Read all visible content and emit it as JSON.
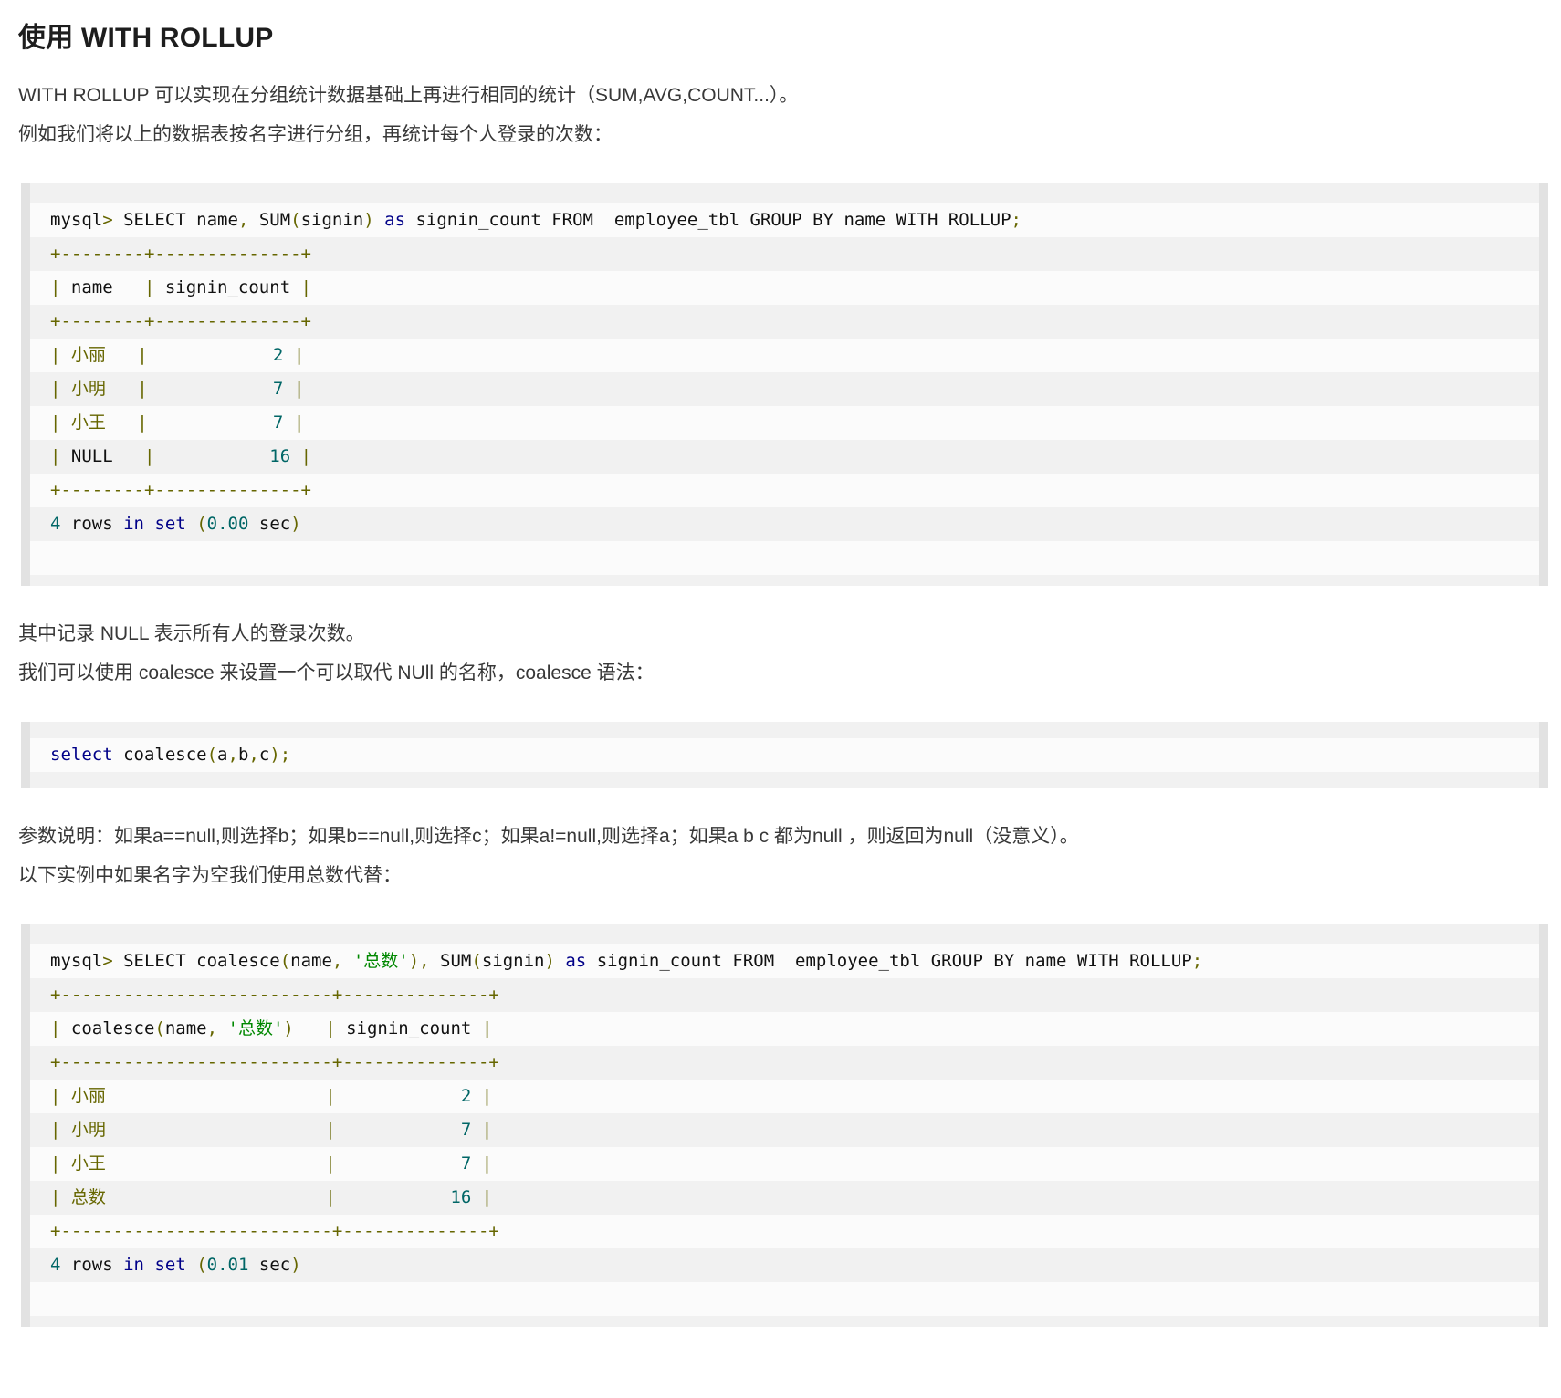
{
  "page_title": "使用 WITH ROLLUP",
  "paragraphs": {
    "intro1": "WITH ROLLUP 可以实现在分组统计数据基础上再进行相同的统计（SUM,AVG,COUNT...）。",
    "intro2": "例如我们将以上的数据表按名字进行分组，再统计每个人登录的次数：",
    "null_note": "其中记录 NULL 表示所有人的登录次数。",
    "coalesce_intro": "我们可以使用 coalesce 来设置一个可以取代 NUll 的名称，coalesce 语法：",
    "param_note": "参数说明：如果a==null,则选择b；如果b==null,则选择c；如果a!=null,则选择a；如果a b c 都为null ，则返回为null（没意义）。",
    "example_intro": "以下实例中如果名字为空我们使用总数代替："
  },
  "colors": {
    "code_plain": "#111111",
    "code_keyword": "#000088",
    "code_punctuation": "#666600",
    "code_literal": "#006666",
    "code_string": "#008800",
    "stripe_light": "#fbfbfb",
    "stripe_dark": "#f1f1f1",
    "block_side_border": "#e2e2e2"
  },
  "result_tables": [
    {
      "columns": [
        "name",
        "signin_count"
      ],
      "rows": [
        [
          "小丽",
          2
        ],
        [
          "小明",
          7
        ],
        [
          "小王",
          7
        ],
        [
          "NULL",
          16
        ]
      ],
      "status": "4 rows in set (0.00 sec)"
    },
    {
      "columns": [
        "coalesce(name, '总数')",
        "signin_count"
      ],
      "rows": [
        [
          "小丽",
          2
        ],
        [
          "小明",
          7
        ],
        [
          "小王",
          7
        ],
        [
          "总数",
          16
        ]
      ],
      "status": "4 rows in set (0.01 sec)"
    }
  ],
  "code_blocks": [
    {
      "name": "rollup-query",
      "lines": [
        [
          [
            "pln",
            "mysql"
          ],
          [
            "pun",
            ">"
          ],
          [
            "pln",
            " SELECT name"
          ],
          [
            "pun",
            ","
          ],
          [
            "pln",
            " SUM"
          ],
          [
            "pun",
            "("
          ],
          [
            "pln",
            "signin"
          ],
          [
            "pun",
            ")"
          ],
          [
            "pln",
            " "
          ],
          [
            "kwd",
            "as"
          ],
          [
            "pln",
            " signin_count FROM  employee_tbl GROUP BY name WITH ROLLUP"
          ],
          [
            "pun",
            ";"
          ]
        ],
        [
          [
            "pun",
            "+--------+--------------+"
          ]
        ],
        [
          [
            "pun",
            "|"
          ],
          [
            "pln",
            " name   "
          ],
          [
            "pun",
            "|"
          ],
          [
            "pln",
            " signin_count "
          ],
          [
            "pun",
            "|"
          ]
        ],
        [
          [
            "pun",
            "+--------+--------------+"
          ]
        ],
        [
          [
            "pun",
            "| 小丽   |"
          ],
          [
            "pln",
            "            "
          ],
          [
            "lit",
            "2"
          ],
          [
            "pln",
            " "
          ],
          [
            "pun",
            "|"
          ]
        ],
        [
          [
            "pun",
            "| 小明   |"
          ],
          [
            "pln",
            "            "
          ],
          [
            "lit",
            "7"
          ],
          [
            "pln",
            " "
          ],
          [
            "pun",
            "|"
          ]
        ],
        [
          [
            "pun",
            "| 小王   |"
          ],
          [
            "pln",
            "            "
          ],
          [
            "lit",
            "7"
          ],
          [
            "pln",
            " "
          ],
          [
            "pun",
            "|"
          ]
        ],
        [
          [
            "pun",
            "|"
          ],
          [
            "pln",
            " NULL   "
          ],
          [
            "pun",
            "|"
          ],
          [
            "pln",
            "           "
          ],
          [
            "lit",
            "16"
          ],
          [
            "pln",
            " "
          ],
          [
            "pun",
            "|"
          ]
        ],
        [
          [
            "pun",
            "+--------+--------------+"
          ]
        ],
        [
          [
            "lit",
            "4"
          ],
          [
            "pln",
            " rows "
          ],
          [
            "kwd",
            "in"
          ],
          [
            "pln",
            " "
          ],
          [
            "kwd",
            "set"
          ],
          [
            "pln",
            " "
          ],
          [
            "pun",
            "("
          ],
          [
            "lit",
            "0.00"
          ],
          [
            "pln",
            " sec"
          ],
          [
            "pun",
            ")"
          ]
        ]
      ]
    },
    {
      "name": "coalesce-syntax",
      "lines": [
        [
          [
            "kwd",
            "select"
          ],
          [
            "pln",
            " coalesce"
          ],
          [
            "pun",
            "("
          ],
          [
            "pln",
            "a"
          ],
          [
            "pun",
            ","
          ],
          [
            "pln",
            "b"
          ],
          [
            "pun",
            ","
          ],
          [
            "pln",
            "c"
          ],
          [
            "pun",
            ");"
          ]
        ]
      ]
    },
    {
      "name": "coalesce-query",
      "lines": [
        [
          [
            "pln",
            "mysql"
          ],
          [
            "pun",
            ">"
          ],
          [
            "pln",
            " SELECT coalesce"
          ],
          [
            "pun",
            "("
          ],
          [
            "pln",
            "name"
          ],
          [
            "pun",
            ","
          ],
          [
            "pln",
            " "
          ],
          [
            "str",
            "'总数'"
          ],
          [
            "pun",
            "),"
          ],
          [
            "pln",
            " SUM"
          ],
          [
            "pun",
            "("
          ],
          [
            "pln",
            "signin"
          ],
          [
            "pun",
            ")"
          ],
          [
            "pln",
            " "
          ],
          [
            "kwd",
            "as"
          ],
          [
            "pln",
            " signin_count FROM  employee_tbl GROUP BY name WITH ROLLUP"
          ],
          [
            "pun",
            ";"
          ]
        ],
        [
          [
            "pun",
            "+--------------------------+--------------+"
          ]
        ],
        [
          [
            "pun",
            "|"
          ],
          [
            "pln",
            " coalesce"
          ],
          [
            "pun",
            "("
          ],
          [
            "pln",
            "name"
          ],
          [
            "pun",
            ","
          ],
          [
            "pln",
            " "
          ],
          [
            "str",
            "'总数'"
          ],
          [
            "pun",
            ")"
          ],
          [
            "pln",
            "   "
          ],
          [
            "pun",
            "|"
          ],
          [
            "pln",
            " signin_count "
          ],
          [
            "pun",
            "|"
          ]
        ],
        [
          [
            "pun",
            "+--------------------------+--------------+"
          ]
        ],
        [
          [
            "pun",
            "| 小丽"
          ],
          [
            "pln",
            "                     "
          ],
          [
            "pun",
            "|"
          ],
          [
            "pln",
            "            "
          ],
          [
            "lit",
            "2"
          ],
          [
            "pln",
            " "
          ],
          [
            "pun",
            "|"
          ]
        ],
        [
          [
            "pun",
            "| 小明"
          ],
          [
            "pln",
            "                     "
          ],
          [
            "pun",
            "|"
          ],
          [
            "pln",
            "            "
          ],
          [
            "lit",
            "7"
          ],
          [
            "pln",
            " "
          ],
          [
            "pun",
            "|"
          ]
        ],
        [
          [
            "pun",
            "| 小王"
          ],
          [
            "pln",
            "                     "
          ],
          [
            "pun",
            "|"
          ],
          [
            "pln",
            "            "
          ],
          [
            "lit",
            "7"
          ],
          [
            "pun",
            " |"
          ]
        ],
        [
          [
            "pun",
            "| 总数"
          ],
          [
            "pln",
            "                     "
          ],
          [
            "pun",
            "|"
          ],
          [
            "pln",
            "           "
          ],
          [
            "lit",
            "16"
          ],
          [
            "pln",
            " "
          ],
          [
            "pun",
            "|"
          ]
        ],
        [
          [
            "pun",
            "+--------------------------+--------------+"
          ]
        ],
        [
          [
            "lit",
            "4"
          ],
          [
            "pln",
            " rows "
          ],
          [
            "kwd",
            "in"
          ],
          [
            "pln",
            " "
          ],
          [
            "kwd",
            "set"
          ],
          [
            "pln",
            " "
          ],
          [
            "pun",
            "("
          ],
          [
            "lit",
            "0.01"
          ],
          [
            "pln",
            " sec"
          ],
          [
            "pun",
            ")"
          ]
        ]
      ]
    }
  ]
}
